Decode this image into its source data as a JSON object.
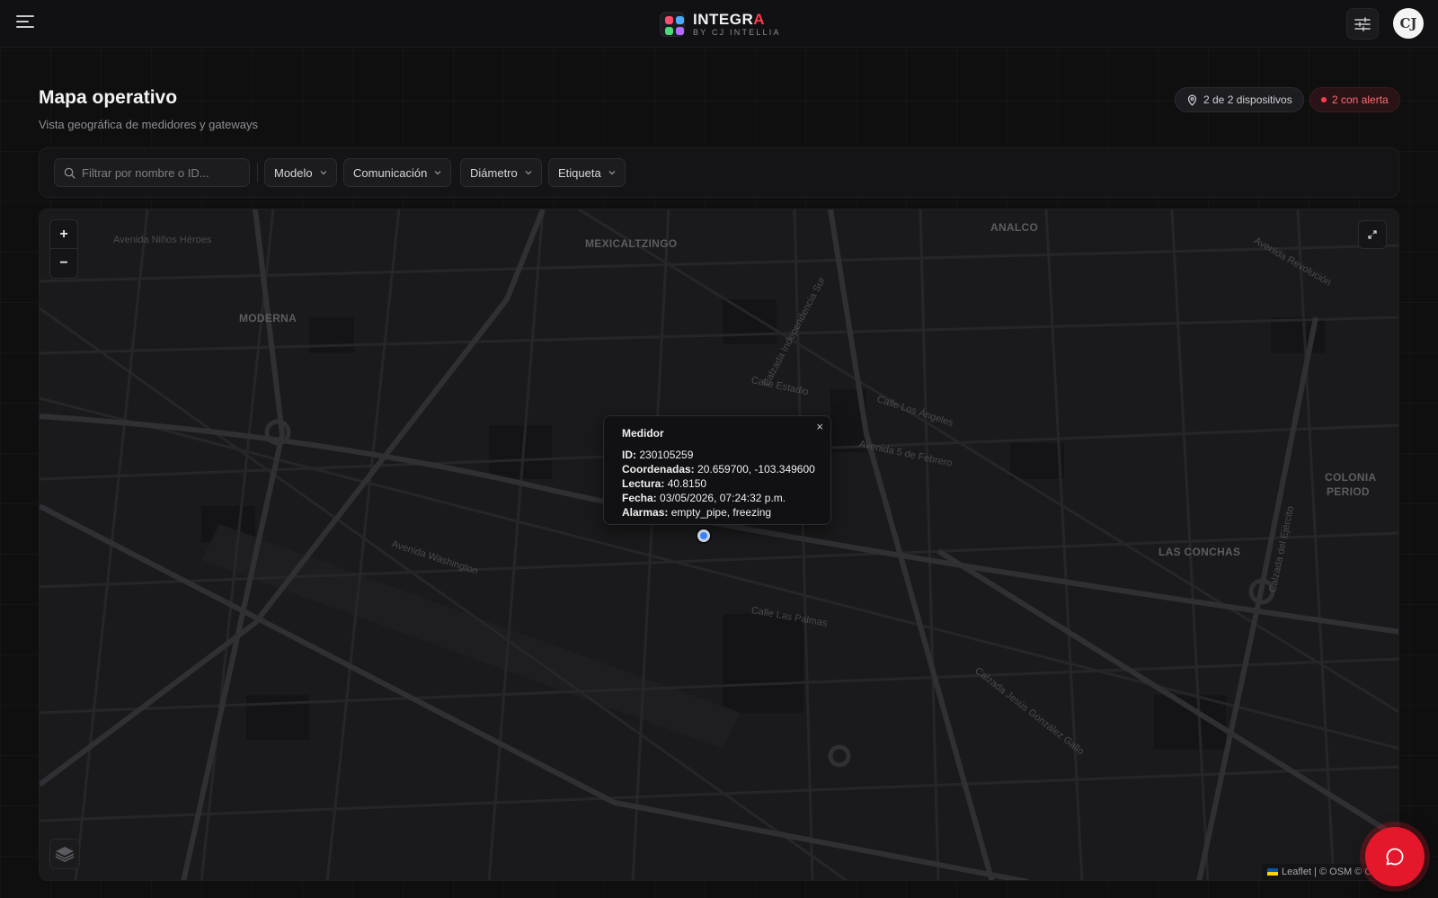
{
  "brand": {
    "name_main": "INTEGR",
    "name_accent": "A",
    "subtitle": "BY CJ INTELLIA",
    "logo_colors": [
      "#ff4d6d",
      "#4dabff",
      "#4cd97b",
      "#b26bff"
    ]
  },
  "avatar": {
    "initials": "CJ"
  },
  "header": {
    "title": "Mapa operativo",
    "subtitle": "Vista geográfica de medidores y gateways",
    "devices_badge": "2 de 2 dispositivos",
    "alert_badge": "2 con alerta"
  },
  "filters": {
    "search_placeholder": "Filtrar por nombre o ID...",
    "dropdowns": [
      "Modelo",
      "Comunicación",
      "Diámetro",
      "Etiqueta"
    ]
  },
  "map": {
    "zoom_in": "+",
    "zoom_out": "−",
    "areas": [
      "MEXICALTZINGO",
      "ANALCO",
      "MODERNA",
      "LAS CONCHAS",
      "COLONIA",
      "PERIOD"
    ],
    "streets": [
      "Avenida Niños Héroes",
      "Avenida Washington",
      "Calle Estadio",
      "Calle Los Ángeles",
      "Avenida 5 de Febrero",
      "Calzada Independencia Sur",
      "Calzada del Ejército",
      "Avenida Revolución",
      "Calzada Jesús González Gallo",
      "Calle Las Palmas"
    ],
    "attribution": "Leaflet | © OSM © CA",
    "popup": {
      "title": "Medidor",
      "id_label": "ID:",
      "id_value": "230105259",
      "coords_label": "Coordenadas:",
      "coords_value": "20.659700, -103.349600",
      "reading_label": "Lectura:",
      "reading_value": "40.8150",
      "date_label": "Fecha:",
      "date_value": "03/05/2026, 07:24:32 p.m.",
      "alarms_label": "Alarmas:",
      "alarms_value": "empty_pipe, freezing",
      "close": "×"
    }
  },
  "colors": {
    "accent_red": "#e5172b",
    "marker_blue": "#3b82f6",
    "background": "#0f0f10"
  },
  "icons": [
    "menu-icon",
    "sliders-icon",
    "map-pin-icon",
    "search-icon",
    "chevron-down-icon",
    "fullscreen-icon",
    "layers-icon",
    "chat-icon"
  ]
}
